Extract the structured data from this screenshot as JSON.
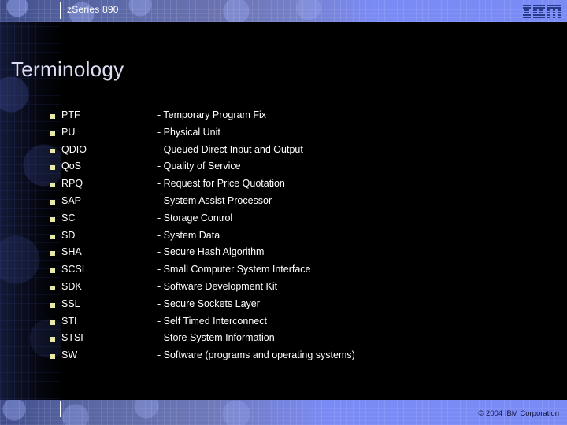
{
  "header": {
    "title": "zSeries 890",
    "logo": "ibm-logo"
  },
  "slide": {
    "title": "Terminology"
  },
  "terms": [
    {
      "abbr": "PTF",
      "desc": "- Temporary Program Fix"
    },
    {
      "abbr": "PU",
      "desc": "- Physical Unit"
    },
    {
      "abbr": "QDIO",
      "desc": "- Queued Direct Input and Output"
    },
    {
      "abbr": "QoS",
      "desc": "- Quality of Service"
    },
    {
      "abbr": "RPQ",
      "desc": "- Request for Price Quotation"
    },
    {
      "abbr": "SAP",
      "desc": "- System Assist Processor"
    },
    {
      "abbr": "SC",
      "desc": "- Storage Control"
    },
    {
      "abbr": "SD",
      "desc": "- System Data"
    },
    {
      "abbr": "SHA",
      "desc": "- Secure Hash Algorithm"
    },
    {
      "abbr": "SCSI",
      "desc": "- Small Computer System Interface"
    },
    {
      "abbr": "SDK",
      "desc": "- Software Development Kit"
    },
    {
      "abbr": "SSL",
      "desc": "- Secure Sockets Layer"
    },
    {
      "abbr": "STI",
      "desc": "- Self Timed Interconnect"
    },
    {
      "abbr": "STSI",
      "desc": "- Store System Information"
    },
    {
      "abbr": "SW",
      "desc": "- Software (programs and operating systems)"
    }
  ],
  "footer": {
    "copyright": "© 2004 IBM Corporation"
  },
  "colors": {
    "background": "#000000",
    "band_accent": "#7b8bf5",
    "band_dark": "#3c4a86",
    "bullet": "#e9e9a6",
    "title_text": "#dcdcf2",
    "body_text": "#ffffff",
    "logo": "#2a3a8a"
  }
}
